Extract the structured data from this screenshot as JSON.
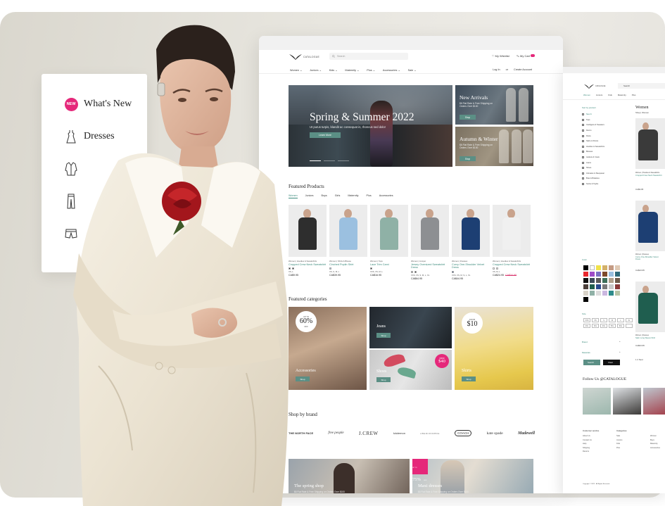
{
  "menu": {
    "new_badge": "NEW",
    "whats_new": "What's New",
    "dresses": "Dresses"
  },
  "store": {
    "brand": "CATALOGUE",
    "search_placeholder": "Search",
    "wishlist": "My Wishlist",
    "cart": "My Cart",
    "nav": [
      "Women",
      "Juniors",
      "Kids",
      "Maternity",
      "Plus",
      "Accessories",
      "Sale"
    ],
    "log_in": "Log In",
    "or": "or",
    "create_account": "Create Account",
    "hero": {
      "title": "Spring & Summer 2022",
      "subtitle": "Ut purus turpis, blandit ac consequat in, rhoncus sed dolor",
      "button": "Learn More"
    },
    "promos": [
      {
        "title": "New Arrivals",
        "subtitle": "$6 Flat Rate & Free Shipping on Orders Over $100",
        "button": "Shop"
      },
      {
        "title": "Autumn & Winter",
        "subtitle": "$6 Flat Rate & Free Shipping on Orders Over $100",
        "button": "Shop"
      }
    ],
    "featured_title": "Featured Products",
    "featured_tabs": [
      "Women",
      "Juniors",
      "Boys",
      "Girls",
      "Maternity",
      "Plus",
      "Accessories"
    ],
    "products": [
      {
        "crumb": "Women | Hoodies & Sweatshirts",
        "name": "Cropped Crew Neck Sweatshirt",
        "sizes": "XS, L",
        "price": "CA$9.95",
        "old": ""
      },
      {
        "crumb": "Women | Shirts & Blouse",
        "name": "Cinched Poplin Shirt",
        "sizes": "XS, S, M, L",
        "price": "CA$39.95",
        "old": ""
      },
      {
        "crumb": "Women | Tops",
        "name": "Lace Trim Cami",
        "sizes": "XXS, XS, M, L",
        "price": "CA$16.95",
        "old": ""
      },
      {
        "crumb": "Women | Jumper",
        "name": "Jersey Oversized Sweatshirt Dress",
        "sizes": "XXS, XS, S, M, L, XL",
        "price": "CA$64.95",
        "old": ""
      },
      {
        "crumb": "Women | Dresses",
        "name": "Curvy One-Shoulder Velvet Dress",
        "sizes": "XXS, XS, M, S, L, XL",
        "price": "CA$44.95",
        "old": ""
      },
      {
        "crumb": "Women | Hoodies & Sweatshirts",
        "name": "Cropped Crew Neck Sweatshirt",
        "sizes": "XS, M, L",
        "price": "CA$24.95",
        "old": "CA$34.95"
      }
    ],
    "categories_title": "Featured categories",
    "categories": {
      "accessories": {
        "label": "Accessories",
        "button": "Shop",
        "badge_top": "UP TO",
        "badge_value": "60%",
        "badge_bottom": "OFF"
      },
      "jeans": {
        "label": "Jeans",
        "button": "Shop"
      },
      "shoes": {
        "label": "Shoes",
        "button": "Shop",
        "badge_top": "FROM",
        "badge_value": "$40"
      },
      "skirts": {
        "label": "Skirts",
        "button": "Shop",
        "badge_top": "FROM",
        "badge_value": "$10"
      }
    },
    "brands_title": "Shop by brand",
    "brands": [
      "THE NORTH FACE",
      "free people",
      "J.CREW",
      "lululemon",
      "ABERCROMBIE",
      "COACH",
      "kate spade",
      "Madewell"
    ],
    "bottom_promos": [
      {
        "title": "The spring shop",
        "subtitle": "$6 Flat Rate & Free Shipping on Orders Over $100"
      },
      {
        "title": "Maxi dresses",
        "subtitle": "$6 Flat Rate & Free Shipping on Orders Over $100",
        "badge_top": "UP TO",
        "badge_value": "75%",
        "badge_bottom": "OFF"
      }
    ]
  },
  "listing": {
    "search_placeholder": "Search",
    "nav": [
      "Women",
      "Juniors",
      "Kids",
      "Maternity",
      "Plus"
    ],
    "sort_title": "Sort by product",
    "filters": [
      "New In",
      "Tops",
      "Cardigans & Sweaters",
      "Denim",
      "Pants",
      "Skirts & Shorts",
      "Hoodies & Sweatshirts",
      "Blouses",
      "Jackets & Coats",
      "Jeans",
      "Shoes",
      "Intimates & Sleepwear",
      "Bras & Bralettes",
      "Socks & Tights"
    ],
    "color_title": "Color",
    "size_title": "Size",
    "sizes": [
      "XXS",
      "XS",
      "S",
      "M",
      "L",
      "XL",
      "2XL",
      "3XL",
      "4XL",
      "5XL",
      "6XL",
      ""
    ],
    "brand_title": "Brand",
    "materials_title": "Materials",
    "apply": "Search",
    "clear": "Clear",
    "page_title": "Women",
    "crumb": "Shop | Women",
    "items": [
      {
        "crumb": "Women | Hoodies & Sweatshirts",
        "name": "Cropped Crew Neck Sweatshirt",
        "price": "CA$9.95"
      },
      {
        "crumb": "Women | Dresses",
        "name": "Curvy One-Shoulder Velvet Dress",
        "price": "CA$44.95"
      },
      {
        "crumb": "Women | Dresses",
        "name": "Satin Long Sleeve Shirt",
        "price": "CA$64.95"
      }
    ],
    "pager": "1  2  Next",
    "follow": "Follow Us @CATALOGUE",
    "footer_cols": [
      {
        "title": "Customer service",
        "links": [
          "About Us",
          "Contact Us",
          "Help",
          "Shipping",
          "Returns"
        ]
      },
      {
        "title": "Categories",
        "links": [
          "Sale",
          "Juniors",
          "Kids",
          "Plus"
        ]
      },
      {
        "title": "",
        "links": [
          "Women",
          "Boys",
          "Maternity",
          "Accessories"
        ]
      }
    ],
    "copyright": "Copyright © 2022 · All Rights Reserved"
  }
}
